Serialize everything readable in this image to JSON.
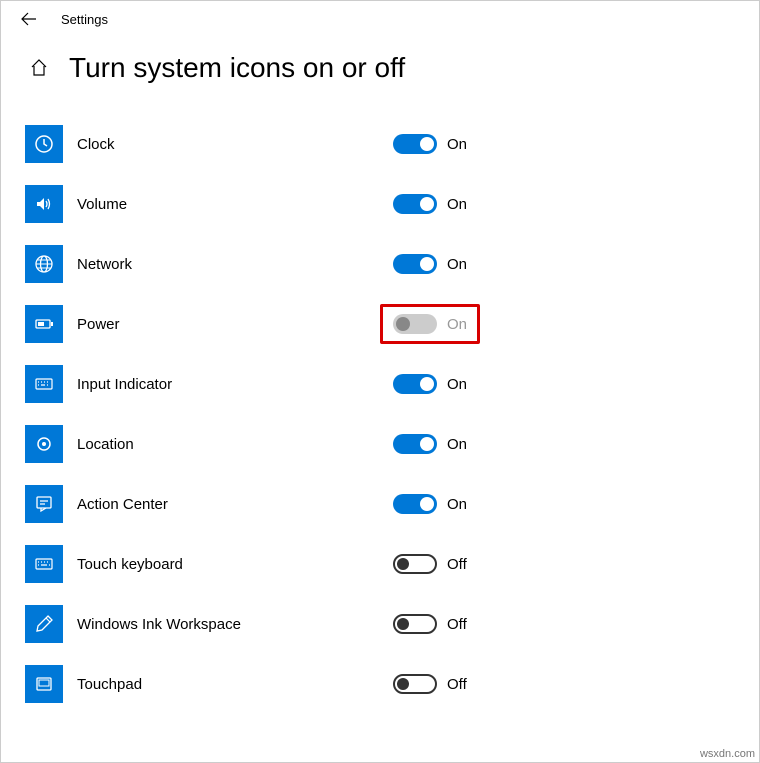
{
  "app_name": "Settings",
  "page_title": "Turn system icons on or off",
  "state_labels": {
    "on": "On",
    "off": "Off"
  },
  "items": [
    {
      "key": "clock",
      "label": "Clock",
      "state": "on",
      "highlight": false
    },
    {
      "key": "volume",
      "label": "Volume",
      "state": "on",
      "highlight": false
    },
    {
      "key": "network",
      "label": "Network",
      "state": "on",
      "highlight": false
    },
    {
      "key": "power",
      "label": "Power",
      "state": "disabled",
      "highlight": true
    },
    {
      "key": "input",
      "label": "Input Indicator",
      "state": "on",
      "highlight": false
    },
    {
      "key": "location",
      "label": "Location",
      "state": "on",
      "highlight": false
    },
    {
      "key": "actioncenter",
      "label": "Action Center",
      "state": "on",
      "highlight": false
    },
    {
      "key": "touchkeyboard",
      "label": "Touch keyboard",
      "state": "off",
      "highlight": false
    },
    {
      "key": "ink",
      "label": "Windows Ink Workspace",
      "state": "off",
      "highlight": false
    },
    {
      "key": "touchpad",
      "label": "Touchpad",
      "state": "off",
      "highlight": false
    }
  ],
  "watermark": "wsxdn.com"
}
